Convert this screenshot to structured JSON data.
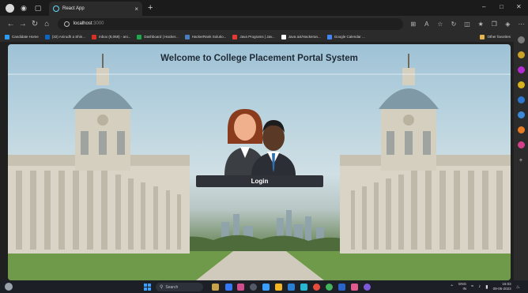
{
  "browser": {
    "tab_title": "React App",
    "url_host": "localhost",
    "url_port": ":3000",
    "favorites": [
      {
        "label": "Candidate Home",
        "color": "#2e9bf0"
      },
      {
        "label": "(32) Anirudh a Shin...",
        "color": "#0a66c2"
      },
      {
        "label": "Inbox (8,068) - ani...",
        "color": "#d93025"
      },
      {
        "label": "Dashboard | Hacker...",
        "color": "#1ba94c"
      },
      {
        "label": "HackerRank Solutio...",
        "color": "#4a7dbd"
      },
      {
        "label": "Java Programs | Jav...",
        "color": "#e53935"
      },
      {
        "label": "Java ai4/Hackeran...",
        "color": "#ffffff"
      },
      {
        "label": "Google Calendar ...",
        "color": "#4285f4"
      }
    ],
    "other_favorites": "Other favorites"
  },
  "page": {
    "headline": "Welcome to College Placement Portal System",
    "login_label": "Login"
  },
  "taskbar": {
    "search_label": "Search",
    "lang_top": "ENG",
    "lang_bottom": "IN",
    "time": "15:03",
    "date": "09-05-2023"
  },
  "colors": {
    "accent": "#3aa0ff",
    "button_bg": "#2f3238",
    "browser_dark": "#2b2b2b"
  }
}
